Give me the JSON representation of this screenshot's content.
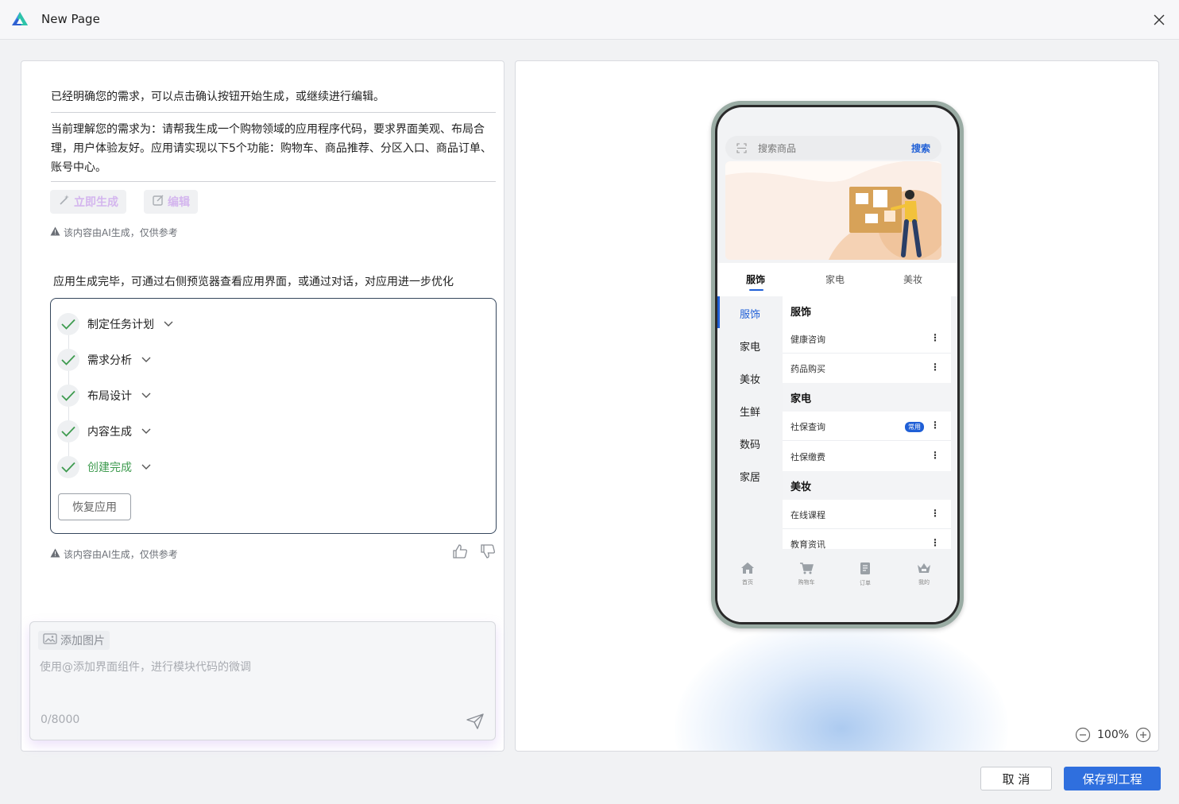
{
  "window": {
    "title": "New Page"
  },
  "chat": {
    "confirm_message": "已经明确您的需求，可以点击确认按钮开始生成，或继续进行编辑。",
    "requirement_message": "当前理解您的需求为：请帮我生成一个购物领域的应用程序代码，要求界面美观、布局合理，用户体验友好。应用请实现以下5个功能：购物车、商品推荐、分区入口、商品订单、账号中心。",
    "generate_now_label": "立即生成",
    "edit_label": "编辑",
    "ai_disclaimer": "该内容由AI生成，仅供参考",
    "complete_message": "应用生成完毕，可通过右侧预览器查看应用界面，或通过对话，对应用进一步优化",
    "tasks": [
      {
        "label": "制定任务计划"
      },
      {
        "label": "需求分析"
      },
      {
        "label": "布局设计"
      },
      {
        "label": "内容生成"
      },
      {
        "label": "创建完成"
      }
    ],
    "restore_label": "恢复应用"
  },
  "input": {
    "add_image_label": "添加图片",
    "placeholder": "使用@添加界面组件，进行模块代码的微调",
    "counter": "0/8000"
  },
  "preview": {
    "zoom": "100%",
    "app": {
      "search_placeholder": "搜索商品",
      "search_button": "搜索",
      "category_tabs": [
        "服饰",
        "家电",
        "美妆"
      ],
      "side_categories": [
        "服饰",
        "家电",
        "美妆",
        "生鲜",
        "数码",
        "家居"
      ],
      "sections": [
        {
          "title": "服饰",
          "items": [
            {
              "label": "健康咨询"
            },
            {
              "label": "药品购买"
            }
          ]
        },
        {
          "title": "家电",
          "items": [
            {
              "label": "社保查询",
              "tag": "常用"
            },
            {
              "label": "社保缴费"
            }
          ]
        },
        {
          "title": "美妆",
          "items": [
            {
              "label": "在线课程"
            },
            {
              "label": "教育资讯"
            }
          ]
        }
      ],
      "more_symbol": "⋮",
      "bottom_nav": [
        "首页",
        "购物车",
        "订单",
        "我的"
      ]
    }
  },
  "footer": {
    "cancel_label": "取 消",
    "save_label": "保存到工程"
  },
  "colors": {
    "accent": "#2f6fde",
    "success": "#3e9b4f",
    "disabled_text": "#d4b6ee"
  }
}
